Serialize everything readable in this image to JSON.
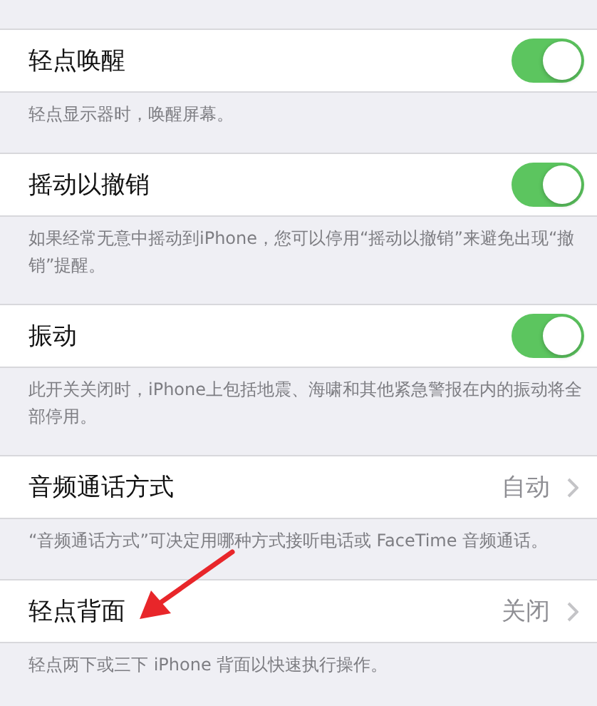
{
  "sections": [
    {
      "kind": "toggle",
      "label": "轻点唤醒",
      "on": true,
      "footer": "轻点显示器时，唤醒屏幕。"
    },
    {
      "kind": "toggle",
      "label": "摇动以撤销",
      "on": true,
      "footer": "如果经常无意中摇动到iPhone，您可以停用“摇动以撤销”来避免出现“撤销”提醒。"
    },
    {
      "kind": "toggle",
      "label": "振动",
      "on": true,
      "footer": "此开关关闭时，iPhone上包括地震、海啸和其他紧急警报在内的振动将全部停用。"
    },
    {
      "kind": "link",
      "label": "音频通话方式",
      "value": "自动",
      "footer": "“音频通话方式”可决定用哪种方式接听电话或 FaceTime 音频通话。"
    },
    {
      "kind": "link",
      "label": "轻点背面",
      "value": "关闭",
      "footer": "轻点两下或三下 iPhone 背面以快速执行操作。"
    }
  ]
}
